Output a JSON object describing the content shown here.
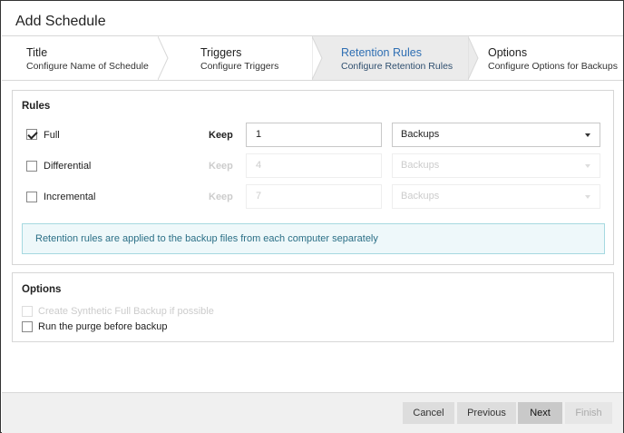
{
  "dialog": {
    "title": "Add Schedule"
  },
  "steps": [
    {
      "title": "Title",
      "subtitle": "Configure Name of Schedule",
      "active": false
    },
    {
      "title": "Triggers",
      "subtitle": "Configure Triggers",
      "active": false
    },
    {
      "title": "Retention Rules",
      "subtitle": "Configure Retention Rules",
      "active": true
    },
    {
      "title": "Options",
      "subtitle": "Configure Options for Backups",
      "active": false
    }
  ],
  "rules": {
    "heading": "Rules",
    "keep_label": "Keep",
    "rows": [
      {
        "label": "Full",
        "checked": true,
        "enabled": true,
        "value": "1",
        "unit": "Backups"
      },
      {
        "label": "Differential",
        "checked": false,
        "enabled": false,
        "value": "4",
        "unit": "Backups"
      },
      {
        "label": "Incremental",
        "checked": false,
        "enabled": false,
        "value": "7",
        "unit": "Backups"
      }
    ],
    "info": "Retention rules are applied to the backup files from each computer separately"
  },
  "options": {
    "heading": "Options",
    "items": [
      {
        "label": "Create Synthetic Full Backup if possible",
        "checked": false,
        "enabled": false
      },
      {
        "label": "Run the purge before backup",
        "checked": false,
        "enabled": true
      }
    ]
  },
  "footer": {
    "cancel": "Cancel",
    "previous": "Previous",
    "next": "Next",
    "finish": "Finish"
  },
  "colors": {
    "active_step": "#2f6fb3",
    "info_bg": "#eef8fa",
    "info_text": "#2b6f86"
  }
}
